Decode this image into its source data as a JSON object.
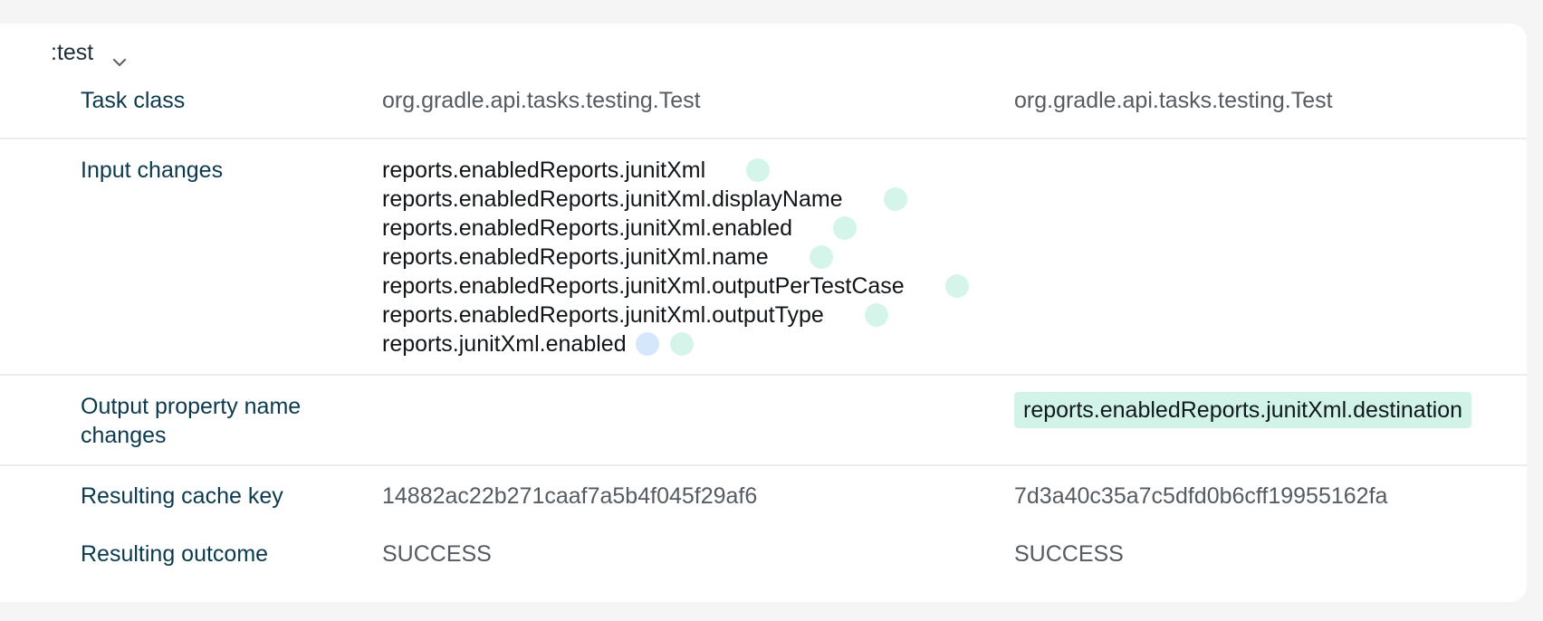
{
  "task": {
    "name": ":test"
  },
  "rows": {
    "task_class": {
      "label": "Task class",
      "left": "org.gradle.api.tasks.testing.Test",
      "right": "org.gradle.api.tasks.testing.Test"
    },
    "input_changes": {
      "label": "Input changes",
      "items": [
        "reports.enabledReports.junitXml",
        "reports.enabledReports.junitXml.displayName",
        "reports.enabledReports.junitXml.enabled",
        "reports.enabledReports.junitXml.name",
        "reports.enabledReports.junitXml.outputPerTestCase",
        "reports.enabledReports.junitXml.outputType",
        "reports.junitXml.enabled"
      ]
    },
    "output_property_name_changes": {
      "label_line1": "Output property name",
      "label_line2": "changes",
      "right": "reports.enabledReports.junitXml.destination"
    },
    "resulting_cache_key": {
      "label": "Resulting cache key",
      "left": "14882ac22b271caaf7a5b4f045f29af6",
      "right": "7d3a40c35a7c5dfd0b6cff19955162fa"
    },
    "resulting_outcome": {
      "label": "Resulting outcome",
      "left": "SUCCESS",
      "right": "SUCCESS"
    }
  },
  "colors": {
    "added_dot": "#d5f5ea",
    "removed_dot": "#d5e8fb",
    "highlight_tag": "#d2f4e8"
  },
  "icons": {
    "toggle": "chevron-down-icon",
    "added_marker": "added-indicator-icon",
    "removed_marker": "removed-indicator-icon"
  }
}
